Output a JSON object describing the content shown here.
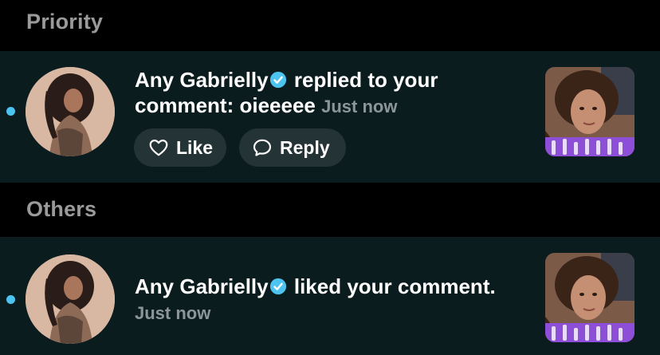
{
  "sections": {
    "priority_title": "Priority",
    "others_title": "Others"
  },
  "notifications": [
    {
      "user": "Any Gabrielly",
      "action": "replied to your comment: oieeeee",
      "time": "Just now",
      "like_label": "Like",
      "reply_label": "Reply"
    },
    {
      "user": "Any Gabrielly",
      "action": "liked your comment.",
      "time": "Just now"
    }
  ],
  "colors": {
    "background": "#000000",
    "row_background": "#0b1c1f",
    "accent_blue": "#4cc4ef",
    "section_text": "#9a9a9a",
    "meta_text": "#8c9698",
    "pill_background": "#243336"
  }
}
